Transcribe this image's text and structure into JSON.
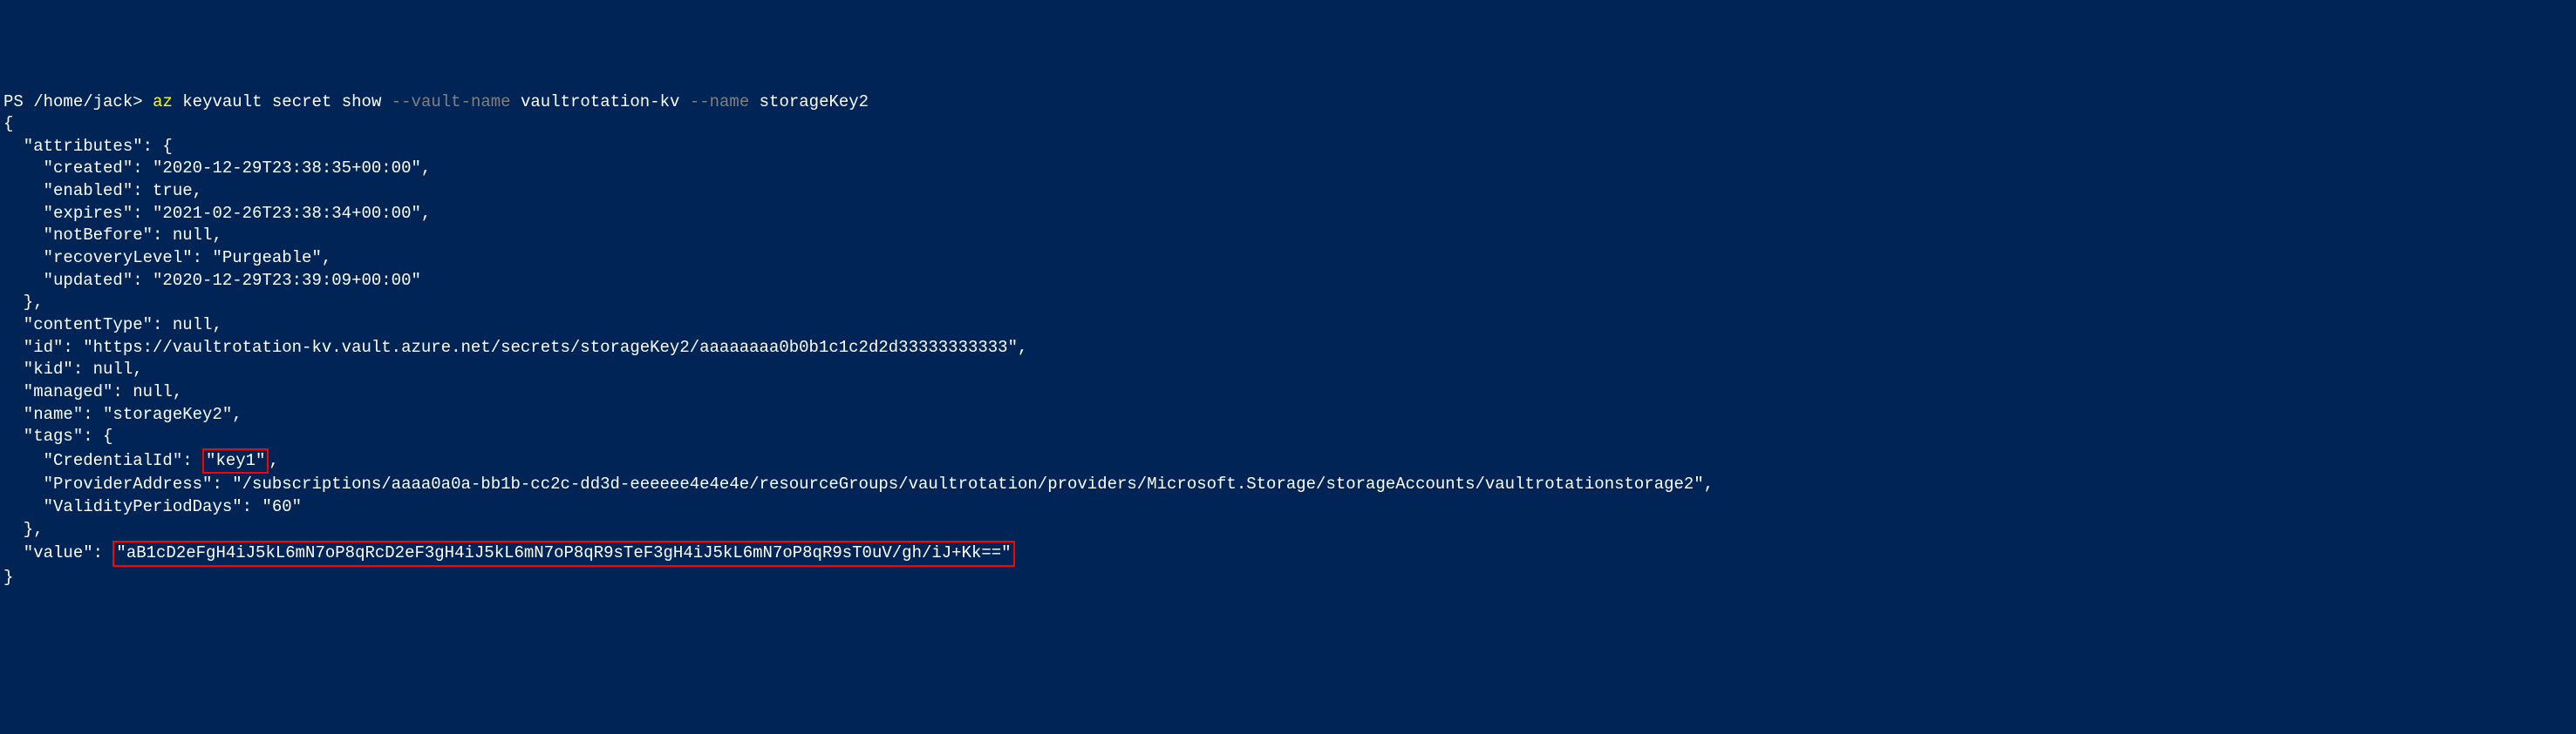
{
  "prompt": {
    "ps": "PS ",
    "path": "/home/jack",
    "gt": "> ",
    "cmd_az": "az ",
    "cmd_keyvault": "keyvault ",
    "cmd_secret": "secret ",
    "cmd_show": "show ",
    "flag_vaultname": "--vault-name ",
    "val_vaultname": "vaultrotation-kv ",
    "flag_name": "--name ",
    "val_name": "storageKey2"
  },
  "output": {
    "open_brace": "{",
    "attributes_key": "  \"attributes\": {",
    "created": "    \"created\": \"2020-12-29T23:38:35+00:00\",",
    "enabled": "    \"enabled\": true,",
    "expires": "    \"expires\": \"2021-02-26T23:38:34+00:00\",",
    "notBefore": "    \"notBefore\": null,",
    "recoveryLevel": "    \"recoveryLevel\": \"Purgeable\",",
    "updated": "    \"updated\": \"2020-12-29T23:39:09+00:00\"",
    "attributes_close": "  },",
    "contentType": "  \"contentType\": null,",
    "id": "  \"id\": \"https://vaultrotation-kv.vault.azure.net/secrets/storageKey2/aaaaaaaa0b0b1c1c2d2d33333333333\",",
    "kid": "  \"kid\": null,",
    "managed": "  \"managed\": null,",
    "name": "  \"name\": \"storageKey2\",",
    "tags_key": "  \"tags\": {",
    "credentialId_pre": "    \"CredentialId\": ",
    "credentialId_val": "\"key1\"",
    "credentialId_post": ",",
    "providerAddress": "    \"ProviderAddress\": \"/subscriptions/aaaa0a0a-bb1b-cc2c-dd3d-eeeeee4e4e4e/resourceGroups/vaultrotation/providers/Microsoft.Storage/storageAccounts/vaultrotationstorage2\",",
    "validityPeriodDays": "    \"ValidityPeriodDays\": \"60\"",
    "tags_close": "  },",
    "value_pre": "  \"value\": ",
    "value_val": "\"aB1cD2eFgH4iJ5kL6mN7oP8qRcD2eF3gH4iJ5kL6mN7oP8qR9sTeF3gH4iJ5kL6mN7oP8qR9sT0uV/gh/iJ+Kk==\"",
    "close_brace": "}"
  }
}
